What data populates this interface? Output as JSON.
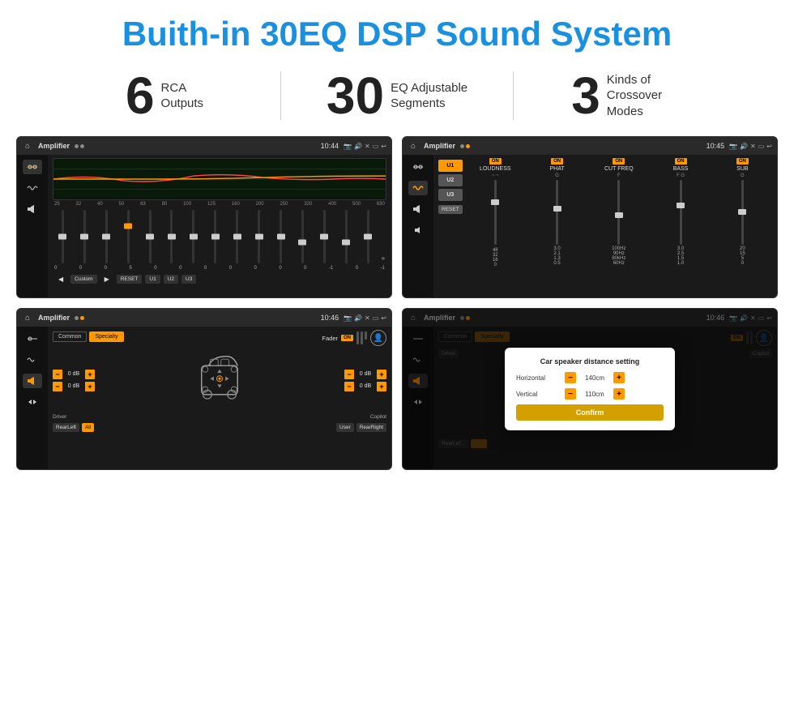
{
  "page": {
    "title": "Buith-in 30EQ DSP Sound System",
    "stats": [
      {
        "number": "6",
        "label": "RCA\nOutputs"
      },
      {
        "number": "30",
        "label": "EQ Adjustable\nSegments"
      },
      {
        "number": "3",
        "label": "Kinds of\nCrossover Modes"
      }
    ]
  },
  "screens": {
    "eq": {
      "topbar": {
        "title": "Amplifier",
        "time": "10:44"
      },
      "frequencies": [
        "25",
        "32",
        "40",
        "50",
        "63",
        "80",
        "100",
        "125",
        "160",
        "200",
        "250",
        "320",
        "400",
        "500",
        "630"
      ],
      "values": [
        "0",
        "0",
        "0",
        "5",
        "0",
        "0",
        "0",
        "0",
        "0",
        "0",
        "0",
        "-1",
        "0",
        "-1"
      ],
      "buttons": [
        "Custom",
        "RESET",
        "U1",
        "U2",
        "U3"
      ]
    },
    "crossover": {
      "topbar": {
        "title": "Amplifier",
        "time": "10:45"
      },
      "presets": [
        "U1",
        "U2",
        "U3"
      ],
      "channels": [
        {
          "name": "LOUDNESS",
          "on": true
        },
        {
          "name": "PHAT",
          "on": true
        },
        {
          "name": "CUT FREQ",
          "on": true
        },
        {
          "name": "BASS",
          "on": true
        },
        {
          "name": "SUB",
          "on": true
        }
      ],
      "reset_label": "RESET"
    },
    "fader": {
      "topbar": {
        "title": "Amplifier",
        "time": "10:46"
      },
      "tabs": [
        "Common",
        "Specialty"
      ],
      "fader_label": "Fader",
      "fader_on": "ON",
      "controls": [
        {
          "label": "0 dB"
        },
        {
          "label": "0 dB"
        },
        {
          "label": "0 dB"
        },
        {
          "label": "0 dB"
        }
      ],
      "buttons": {
        "driver": "Driver",
        "rearLeft": "RearLeft",
        "all": "All",
        "user": "User",
        "rearRight": "RearRight",
        "copilot": "Copilot"
      }
    },
    "dialog": {
      "topbar": {
        "title": "Amplifier",
        "time": "10:46"
      },
      "tabs": [
        "Common",
        "Specialty"
      ],
      "dialog": {
        "title": "Car speaker distance setting",
        "horizontal_label": "Horizontal",
        "horizontal_value": "140cm",
        "vertical_label": "Vertical",
        "vertical_value": "110cm",
        "confirm_label": "Confirm"
      },
      "buttons": {
        "driver": "Driver",
        "rearLeft": "RearLeft",
        "copilot": "Copilot"
      }
    }
  }
}
